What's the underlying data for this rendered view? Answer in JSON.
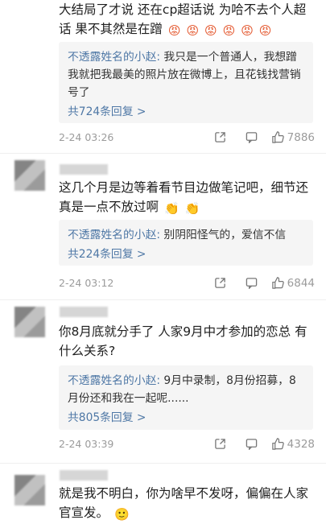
{
  "comments": [
    {
      "text": "大结局了才说 还在cp超话说 为哈不去个人超话 果不其然是在蹭",
      "emojis": [
        "😡",
        "😡",
        "😡",
        "😡",
        "😡",
        "😡"
      ],
      "reply_author": "不透露姓名的小赵:",
      "reply_text": " 我只是一个普通人，我想蹭我就把我最美的照片放在微博上，且花钱找营销号了",
      "reply_count": "共724条回复 >",
      "time": "2-24 03:26",
      "likes": "7886"
    },
    {
      "text": "这几个月是边等着看节目边做笔记吧，细节还真是一点不放过啊",
      "emojis": [
        "👏",
        "👏"
      ],
      "reply_author": "不透露姓名的小赵:",
      "reply_text": " 别阴阳怪气的，爱信不信",
      "reply_count": "共224条回复 >",
      "time": "2-24 03:12",
      "likes": "6844"
    },
    {
      "text": "你8月底就分手了 人家9月中才参加的恋总 有什么关系?",
      "emojis": [],
      "reply_author": "不透露姓名的小赵:",
      "reply_text": " 9月中录制，8月份招募，8月份还和我在一起呢......",
      "reply_count": "共805条回复 >",
      "time": "2-24 03:39",
      "likes": "4328"
    },
    {
      "text": "就是我不明白，你为啥早不发呀，偏偏在人家官宣发。",
      "emojis": [
        "🙂"
      ]
    }
  ],
  "icons": {
    "share": "share-icon",
    "comment": "comment-icon",
    "like": "like-icon"
  },
  "colors": {
    "link": "#4f78a6",
    "meta": "#9b9b9b",
    "reply_bg": "#f5f5f5"
  }
}
